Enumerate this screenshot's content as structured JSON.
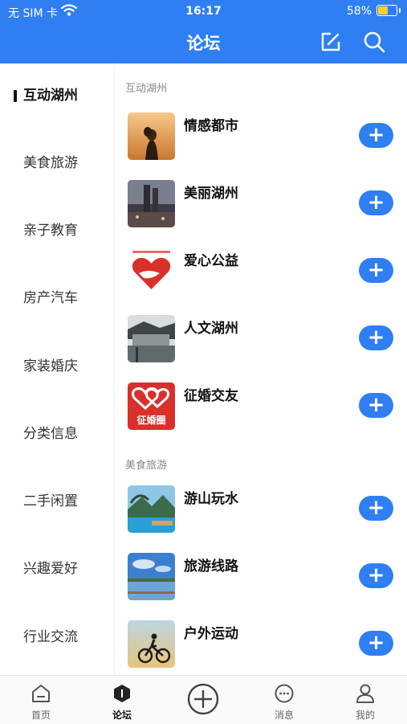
{
  "status": {
    "carrier": "无 SIM 卡",
    "time": "16:17",
    "battery_pct": "58%",
    "battery_level": 0.58
  },
  "nav": {
    "title": "论坛",
    "edit_icon": "edit-icon",
    "search_icon": "search-icon"
  },
  "sidebar": {
    "items": [
      {
        "label": "互动湖州",
        "active": true
      },
      {
        "label": "美食旅游"
      },
      {
        "label": "亲子教育"
      },
      {
        "label": "房产汽车"
      },
      {
        "label": "家装婚庆"
      },
      {
        "label": "分类信息"
      },
      {
        "label": "二手闲置"
      },
      {
        "label": "兴趣爱好"
      },
      {
        "label": "行业交流"
      }
    ]
  },
  "sections": [
    {
      "title": "互动湖州",
      "forums": [
        {
          "name": "情感都市"
        },
        {
          "name": "美丽湖州"
        },
        {
          "name": "爱心公益"
        },
        {
          "name": "人文湖州"
        },
        {
          "name": "征婚交友",
          "thumb_text": "征婚圈"
        }
      ]
    },
    {
      "title": "美食旅游",
      "forums": [
        {
          "name": "游山玩水"
        },
        {
          "name": "旅游线路"
        },
        {
          "name": "户外运动"
        }
      ]
    }
  ],
  "add_label": "+",
  "tabbar": {
    "items": [
      {
        "label": "首页",
        "icon": "home-icon"
      },
      {
        "label": "论坛",
        "icon": "forum-icon",
        "active": true
      },
      {
        "label": "",
        "icon": "post-plus-icon"
      },
      {
        "label": "消息",
        "icon": "message-icon"
      },
      {
        "label": "我的",
        "icon": "profile-icon"
      }
    ]
  },
  "colors": {
    "primary": "#2f7ff2",
    "battery": "#ffd32a"
  }
}
